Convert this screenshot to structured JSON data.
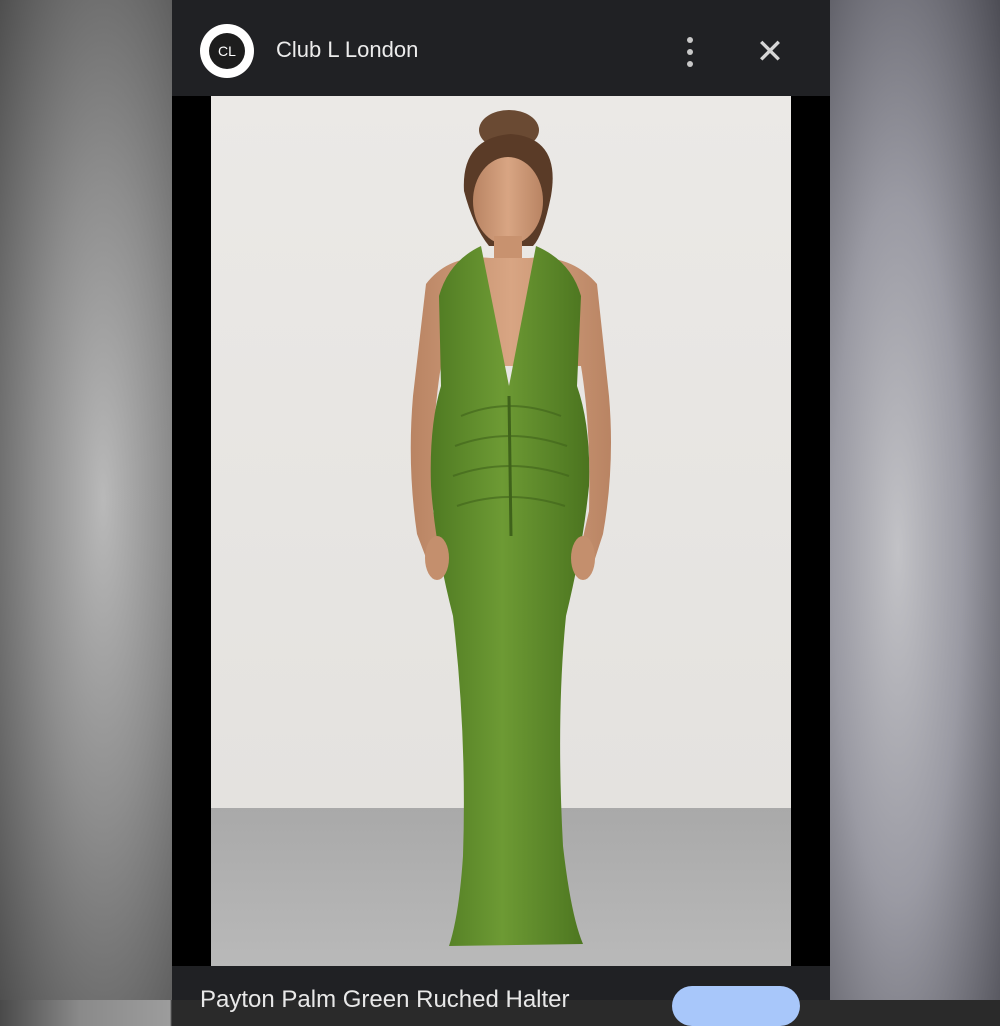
{
  "header": {
    "logo_text": "CL",
    "site_name": "Club L London"
  },
  "actions": {
    "more_icon": "more-vert-icon",
    "close_icon": "close-icon",
    "close_glyph": "✕"
  },
  "image": {
    "subject": "Woman in green ruched halter maxi dress"
  },
  "caption": {
    "title": "Payton Palm Green Ruched Halter"
  },
  "colors": {
    "header_bg": "#202124",
    "dress_green": "#5f8a2a",
    "accent_button": "#a8c7fa"
  }
}
